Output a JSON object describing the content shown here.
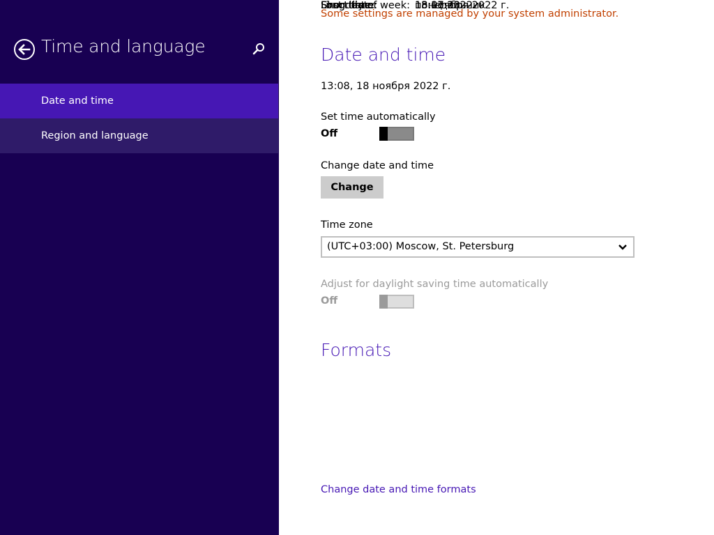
{
  "sidebar": {
    "title": "Time and language",
    "items": [
      {
        "label": "Date and time",
        "selected": true
      },
      {
        "label": "Region and language",
        "selected": false
      }
    ],
    "icons": {
      "back": "back-arrow-icon",
      "search": "search-icon"
    }
  },
  "main": {
    "admin_notice": "Some settings are managed by your system administrator.",
    "date_time": {
      "heading": "Date and time",
      "current": "13:08, 18 ноября 2022 г.",
      "set_auto_label": "Set time automatically",
      "set_auto_state": "Off",
      "change_label": "Change date and time",
      "change_button": "Change",
      "timezone_label": "Time zone",
      "timezone_value": "(UTC+03:00) Moscow, St. Petersburg",
      "dst_label": "Adjust for daylight saving time automatically",
      "dst_state": "Off"
    },
    "formats": {
      "heading": "Formats",
      "rows": [
        {
          "label": "First day of week:",
          "value": "понедельник"
        },
        {
          "label": "Short date:",
          "value": "18.11.2022"
        },
        {
          "label": "Long date:",
          "value": "18 ноября 2022 г."
        },
        {
          "label": "Short time:",
          "value": "13:07"
        },
        {
          "label": "Long time:",
          "value": "13:07:33"
        }
      ],
      "change_link": "Change date and time formats"
    }
  },
  "colors": {
    "sidebar_bg": "#180052",
    "selected_item": "#4617b4",
    "hover_item": "#2f1b69",
    "accent": "#4617b4",
    "warning": "#c14000"
  }
}
